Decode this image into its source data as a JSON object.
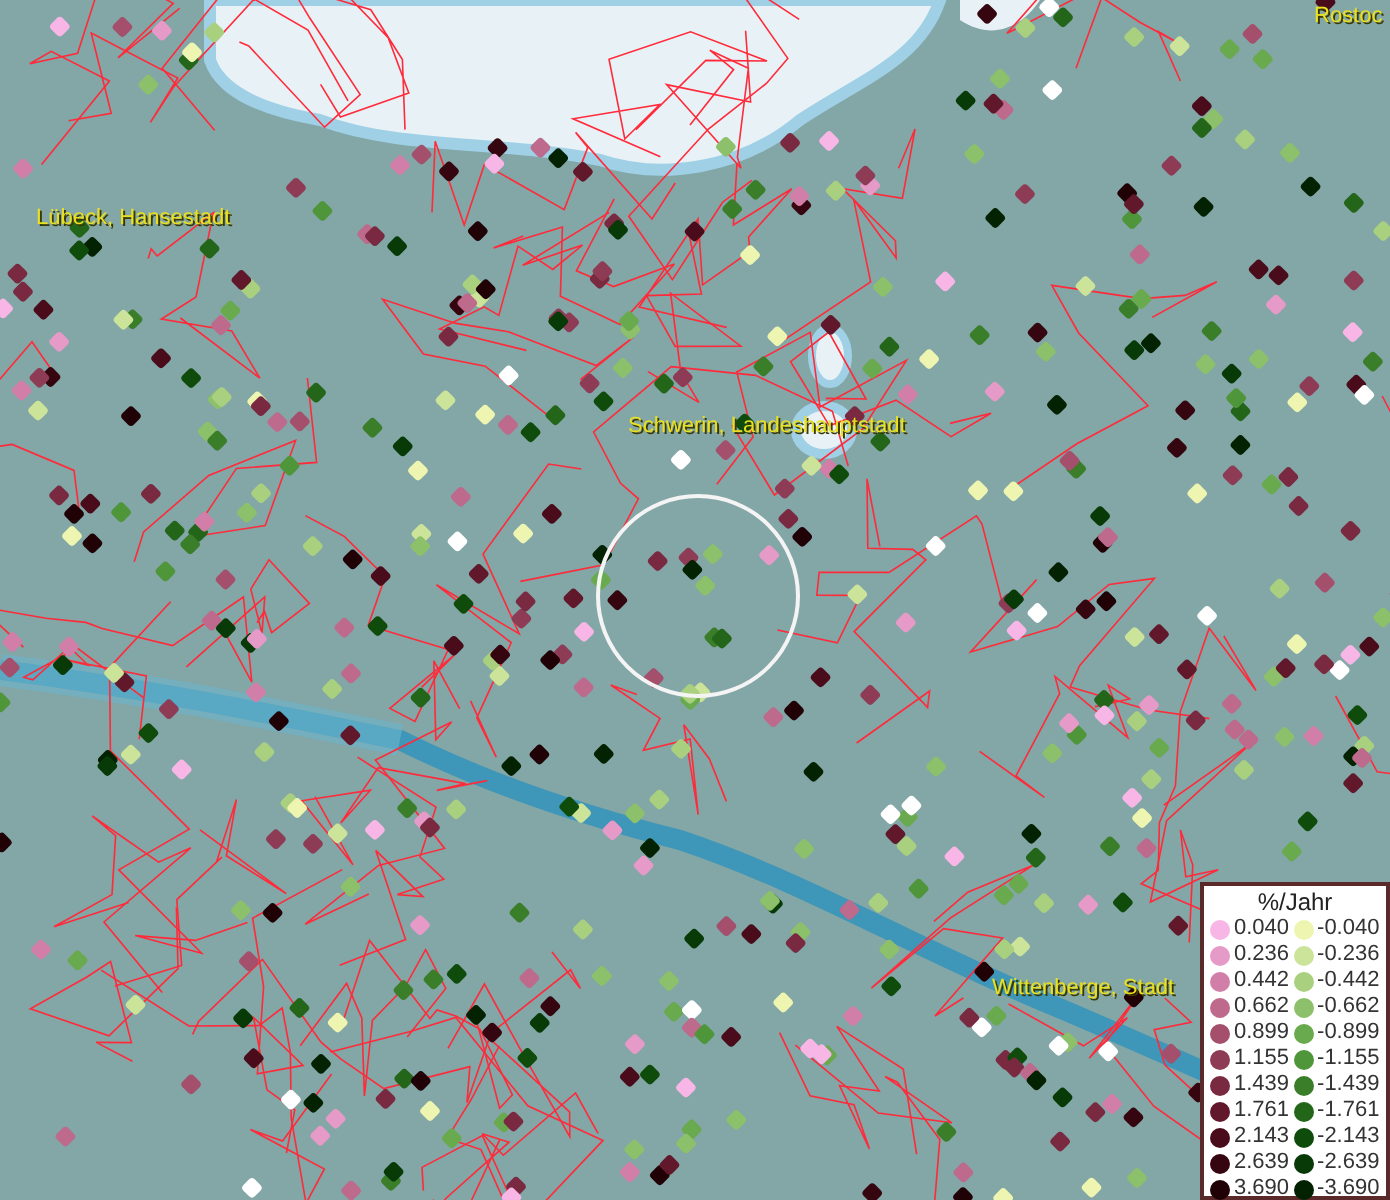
{
  "map": {
    "places": [
      {
        "name": "Lübeck, Hansestadt"
      },
      {
        "name": "Schwerin, Landeshauptstadt"
      },
      {
        "name": "Wittenberge, Stadt"
      },
      {
        "name": "Rostoc"
      }
    ]
  },
  "legend": {
    "title": "%/Jahr",
    "positive": [
      {
        "label": "0.040",
        "color": "#f7b6e6"
      },
      {
        "label": "0.236",
        "color": "#e59ac8"
      },
      {
        "label": "0.442",
        "color": "#d17fa8"
      },
      {
        "label": "0.662",
        "color": "#bd6a8c"
      },
      {
        "label": "0.899",
        "color": "#a44f6c"
      },
      {
        "label": "1.155",
        "color": "#8e3b55"
      },
      {
        "label": "1.439",
        "color": "#7a2a40"
      },
      {
        "label": "1.761",
        "color": "#62182b"
      },
      {
        "label": "2.143",
        "color": "#4a0c1a"
      },
      {
        "label": "2.639",
        "color": "#360610"
      },
      {
        "label": "3.690",
        "color": "#200206"
      }
    ],
    "negative": [
      {
        "label": "-0.040",
        "color": "#eef5b0"
      },
      {
        "label": "-0.236",
        "color": "#cce39a"
      },
      {
        "label": "-0.442",
        "color": "#a9d07f"
      },
      {
        "label": "-0.662",
        "color": "#8cc06a"
      },
      {
        "label": "-0.899",
        "color": "#6aaa4e"
      },
      {
        "label": "-1.155",
        "color": "#4f963a"
      },
      {
        "label": "-1.439",
        "color": "#3a7e2a"
      },
      {
        "label": "-1.761",
        "color": "#23661a"
      },
      {
        "label": "-2.143",
        "color": "#0f4c0c"
      },
      {
        "label": "-2.639",
        "color": "#073a07"
      },
      {
        "label": "-3.690",
        "color": "#022202"
      }
    ]
  }
}
